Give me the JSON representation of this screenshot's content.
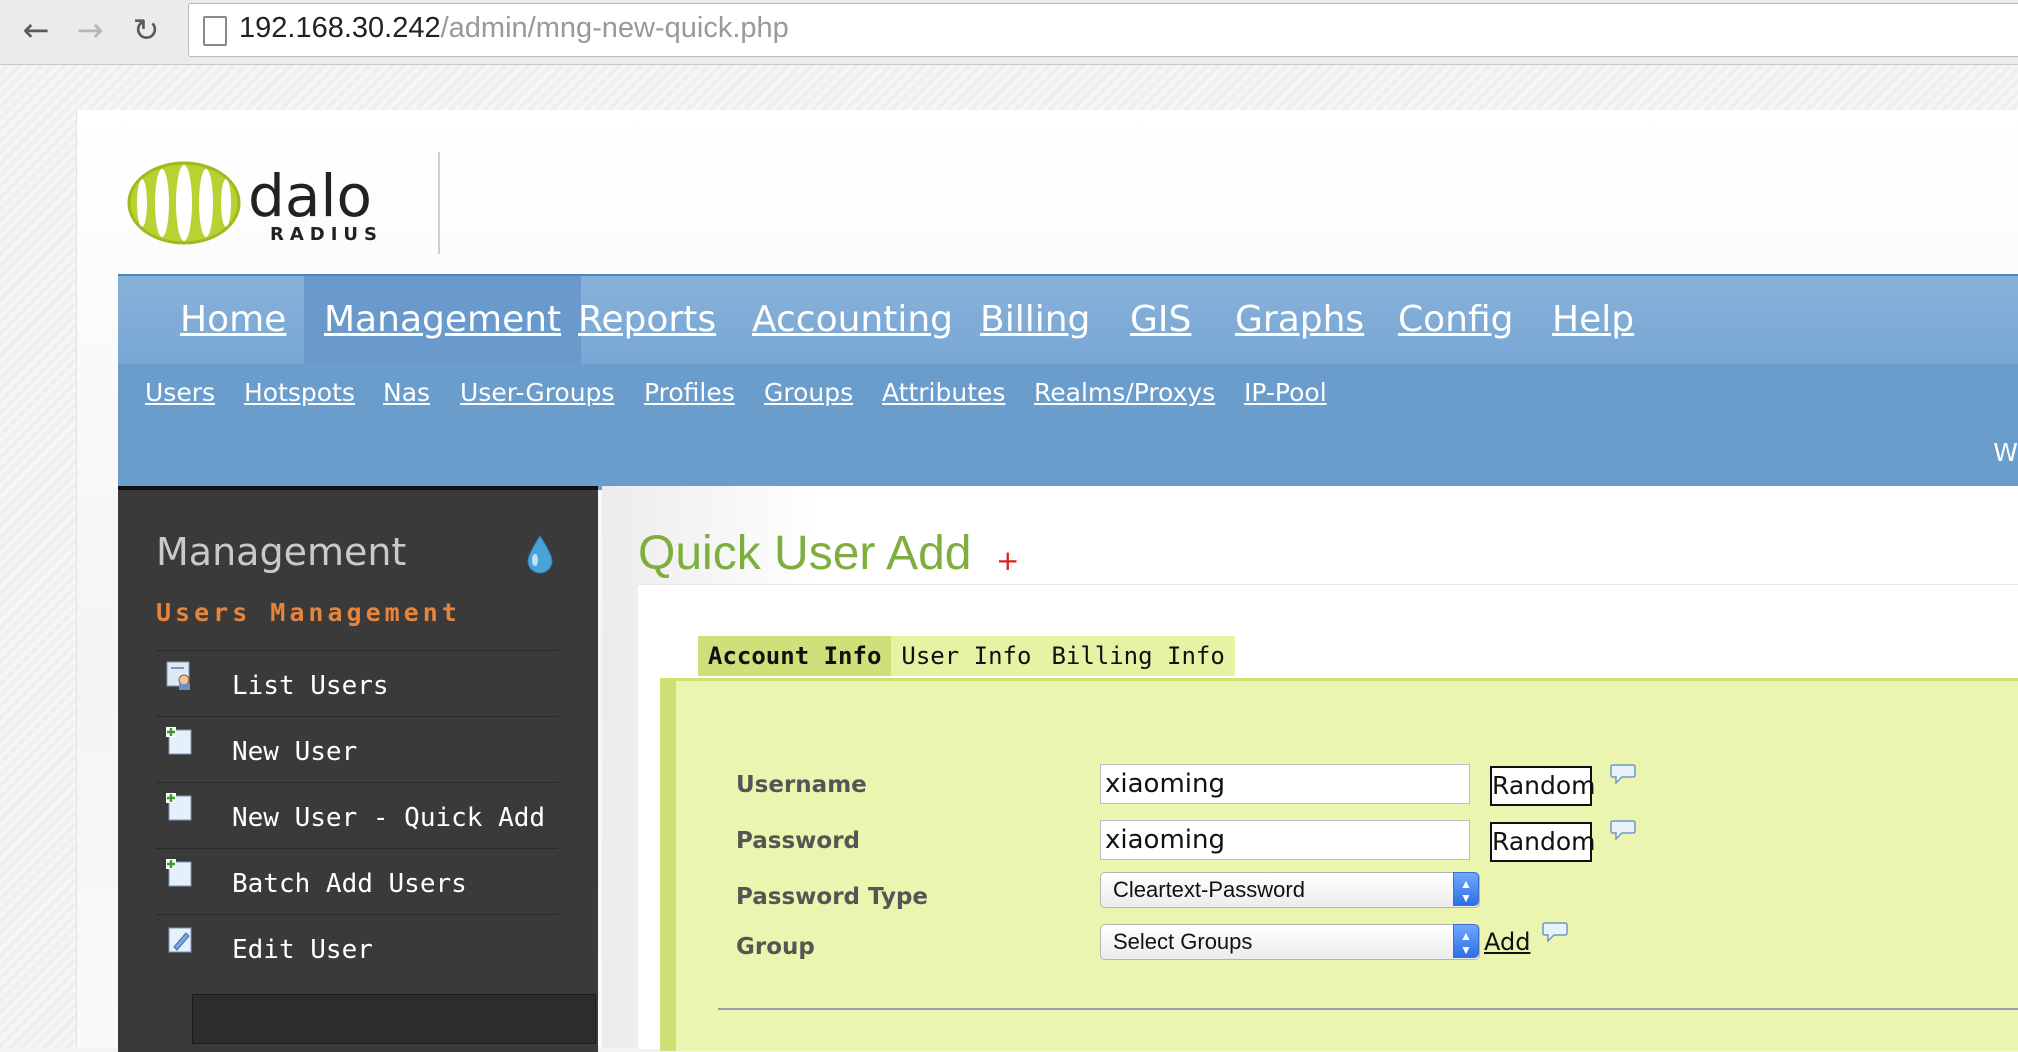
{
  "browser": {
    "url_host": "192.168.30.242",
    "url_path": "/admin/mng-new-quick.php",
    "back_icon": "back-arrow-icon",
    "forward_icon": "forward-arrow-icon",
    "reload_icon": "reload-icon"
  },
  "logo": {
    "word1": "dalo",
    "word2": "RADIUS"
  },
  "main_menu": [
    {
      "label": "Home"
    },
    {
      "label": "Management"
    },
    {
      "label": "Reports"
    },
    {
      "label": "Accounting"
    },
    {
      "label": "Billing"
    },
    {
      "label": "GIS"
    },
    {
      "label": "Graphs"
    },
    {
      "label": "Config"
    },
    {
      "label": "Help"
    }
  ],
  "sub_menu": [
    {
      "label": "Users"
    },
    {
      "label": "Hotspots"
    },
    {
      "label": "Nas"
    },
    {
      "label": "User-Groups"
    },
    {
      "label": "Profiles"
    },
    {
      "label": "Groups"
    },
    {
      "label": "Attributes"
    },
    {
      "label": "Realms/Proxys"
    },
    {
      "label": "IP-Pool"
    }
  ],
  "welcome_text": "W",
  "sidebar": {
    "title": "Management",
    "subtitle": "Users Management",
    "items": [
      {
        "label": "List Users",
        "icon": "users-list-icon"
      },
      {
        "label": "New User",
        "icon": "new-user-icon"
      },
      {
        "label": "New User - Quick Add",
        "icon": "new-user-icon"
      },
      {
        "label": "Batch Add Users",
        "icon": "new-user-icon"
      },
      {
        "label": "Edit User",
        "icon": "edit-user-icon"
      }
    ]
  },
  "content": {
    "title": "Quick User Add",
    "plus": "+",
    "tabs": [
      {
        "label": "Account Info",
        "active": true
      },
      {
        "label": "User Info",
        "active": false
      },
      {
        "label": "Billing Info",
        "active": false
      }
    ],
    "form": {
      "username_label": "Username",
      "username_value": "xiaoming",
      "password_label": "Password",
      "password_value": "xiaoming",
      "random_label": "Random",
      "password_type_label": "Password Type",
      "password_type_value": "Cleartext-Password",
      "group_label": "Group",
      "group_value": "Select Groups",
      "add_label": "Add"
    }
  },
  "colors": {
    "nav_blue": "#79a7d4",
    "title_green": "#7fae3e",
    "panel_green": "#ecf5b0",
    "sidebar_orange": "#e6843d"
  }
}
